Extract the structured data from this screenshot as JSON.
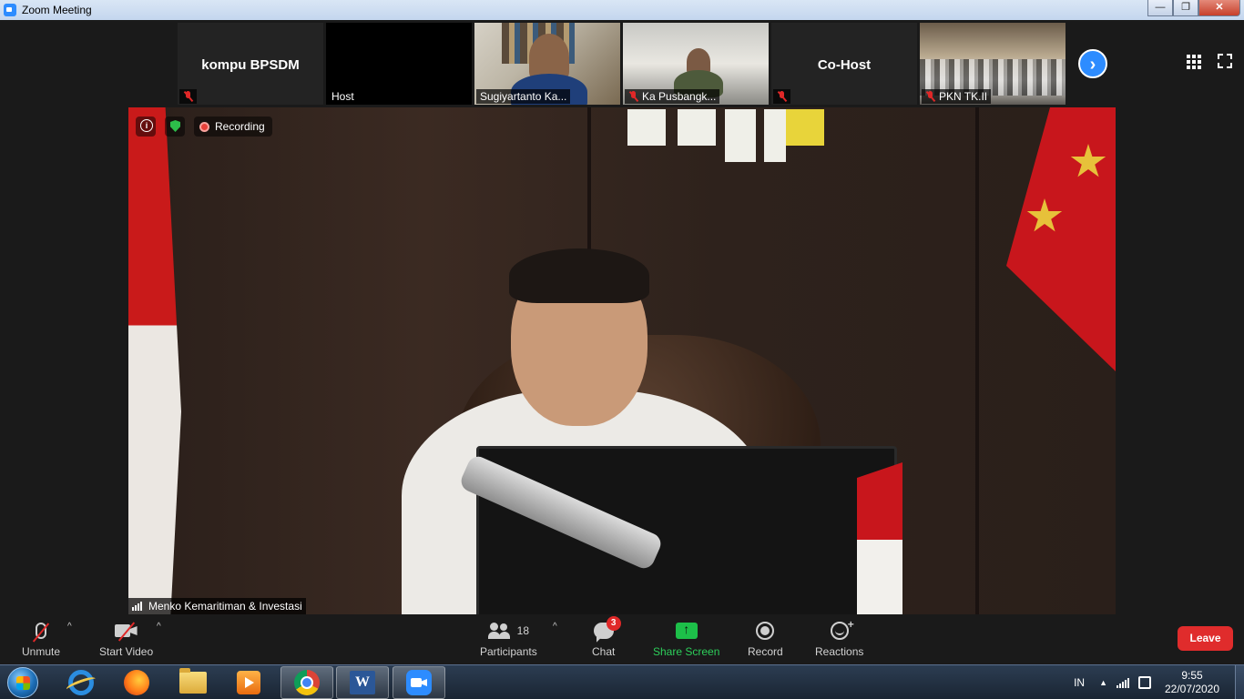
{
  "window": {
    "title": "Zoom Meeting",
    "controls": {
      "minimize": "—",
      "maximize": "❐",
      "close": "✕"
    }
  },
  "thumbnails": [
    {
      "name": "kompu BPSDM",
      "display_name": "",
      "muted": true
    },
    {
      "name": "",
      "display_name": "Host",
      "muted": false
    },
    {
      "name": "",
      "display_name": "Sugiyartanto Ka...",
      "muted": false
    },
    {
      "name": "",
      "display_name": "Ka Pusbangk...",
      "muted": true
    },
    {
      "name": "Co-Host",
      "display_name": "",
      "muted": true
    },
    {
      "name": "",
      "display_name": "PKN TK.II",
      "muted": true
    }
  ],
  "strip": {
    "next_label": "›"
  },
  "main_video": {
    "recording_label": "Recording",
    "speaker_name": "Menko Kemaritiman & Investasi"
  },
  "controls": {
    "unmute_label": "Unmute",
    "start_video_label": "Start Video",
    "participants_label": "Participants",
    "participants_count": "18",
    "chat_label": "Chat",
    "chat_badge": "3",
    "share_label": "Share Screen",
    "record_label": "Record",
    "reactions_label": "Reactions",
    "leave_label": "Leave",
    "caret": "^"
  },
  "taskbar": {
    "apps": [
      "start",
      "internet-explorer",
      "firefox",
      "file-explorer",
      "media-player",
      "chrome",
      "word",
      "zoom"
    ],
    "word_letter": "W",
    "language": "IN",
    "tray_up": "▲",
    "time": "9:55",
    "date": "22/07/2020"
  },
  "colors": {
    "zoom_blue": "#2d8cff",
    "leave_red": "#e02c2c",
    "share_green": "#1dbf49",
    "muted_red": "#e02828"
  }
}
